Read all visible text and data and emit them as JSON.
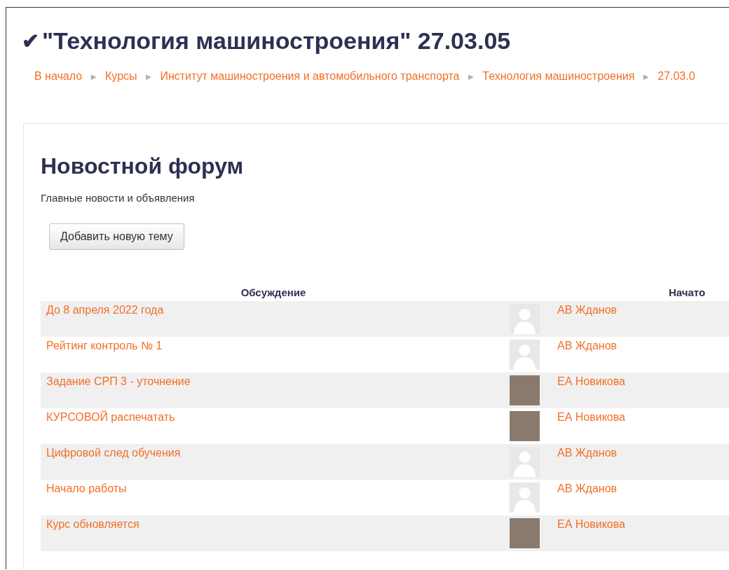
{
  "page": {
    "check_mark": "✔",
    "title": "\"Технология машиностроения\" 27.03.05"
  },
  "breadcrumb": [
    {
      "label": "В начало"
    },
    {
      "label": "Курсы"
    },
    {
      "label": "Институт машиностроения и автомобильного транспорта"
    },
    {
      "label": "Технология машиностроения"
    },
    {
      "label": "27.03.0"
    }
  ],
  "breadcrumb_separator": "►",
  "forum": {
    "title": "Новостной форум",
    "description": "Главные новости и объявления",
    "add_button": "Добавить новую тему"
  },
  "table": {
    "columns": [
      "Обсуждение",
      "Начато"
    ],
    "rows": [
      {
        "topic": "До 8 апреля 2022 года",
        "kind": "default_avatar",
        "author": "АВ Жданов"
      },
      {
        "topic": "Рейтинг контроль № 1",
        "kind": "default_avatar",
        "author": "АВ Жданов"
      },
      {
        "topic": "Задание СРП 3 - уточнение",
        "kind": "photo_avatar",
        "author": "ЕА Новикова"
      },
      {
        "topic": "КУРСОВОЙ распечатать",
        "kind": "photo_avatar",
        "author": "ЕА Новикова"
      },
      {
        "topic": "Цифровой след обучения",
        "kind": "default_avatar",
        "author": "АВ Жданов"
      },
      {
        "topic": "Начало работы",
        "kind": "default_avatar",
        "author": "АВ Жданов"
      },
      {
        "topic": "Курс обновляется",
        "kind": "photo_avatar",
        "author": "ЕА Новикова"
      }
    ]
  }
}
